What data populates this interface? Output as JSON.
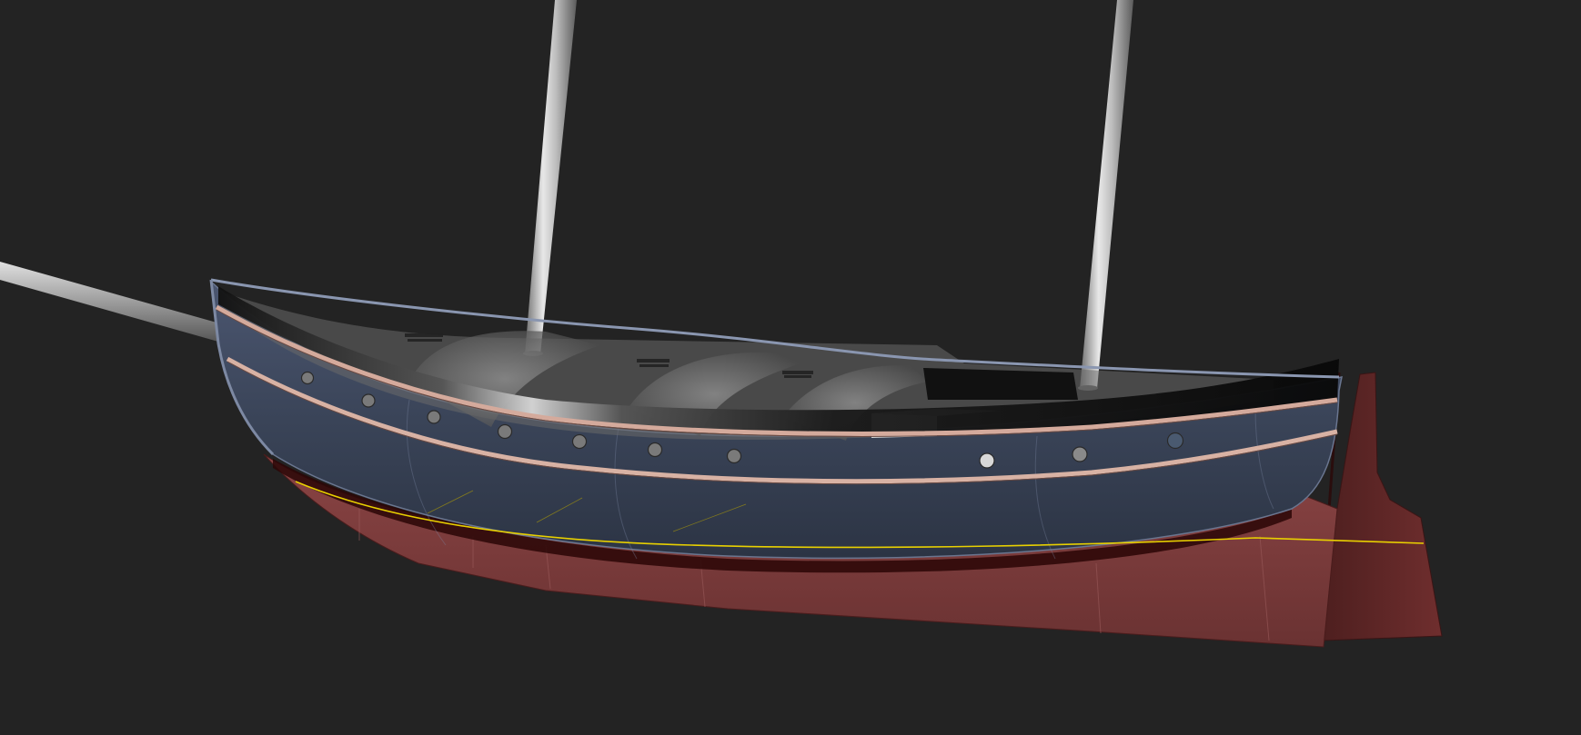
{
  "scene": {
    "description_visible_text": "",
    "colors": {
      "background": "#232323",
      "hull_upper": "#3a4458",
      "hull_upper_light": "#5a6680",
      "hull_lower": "#7a3a3a",
      "hull_lower_dark": "#5a2626",
      "keel": "#6b2c2c",
      "bulwark_black": "#0b0b0b",
      "deck_grey": "#8a8a8a",
      "mast": "#b8b8b8",
      "waterline": "#e8d000",
      "rubrail": "#c9a394",
      "porthole": "#7a7a7a"
    }
  }
}
